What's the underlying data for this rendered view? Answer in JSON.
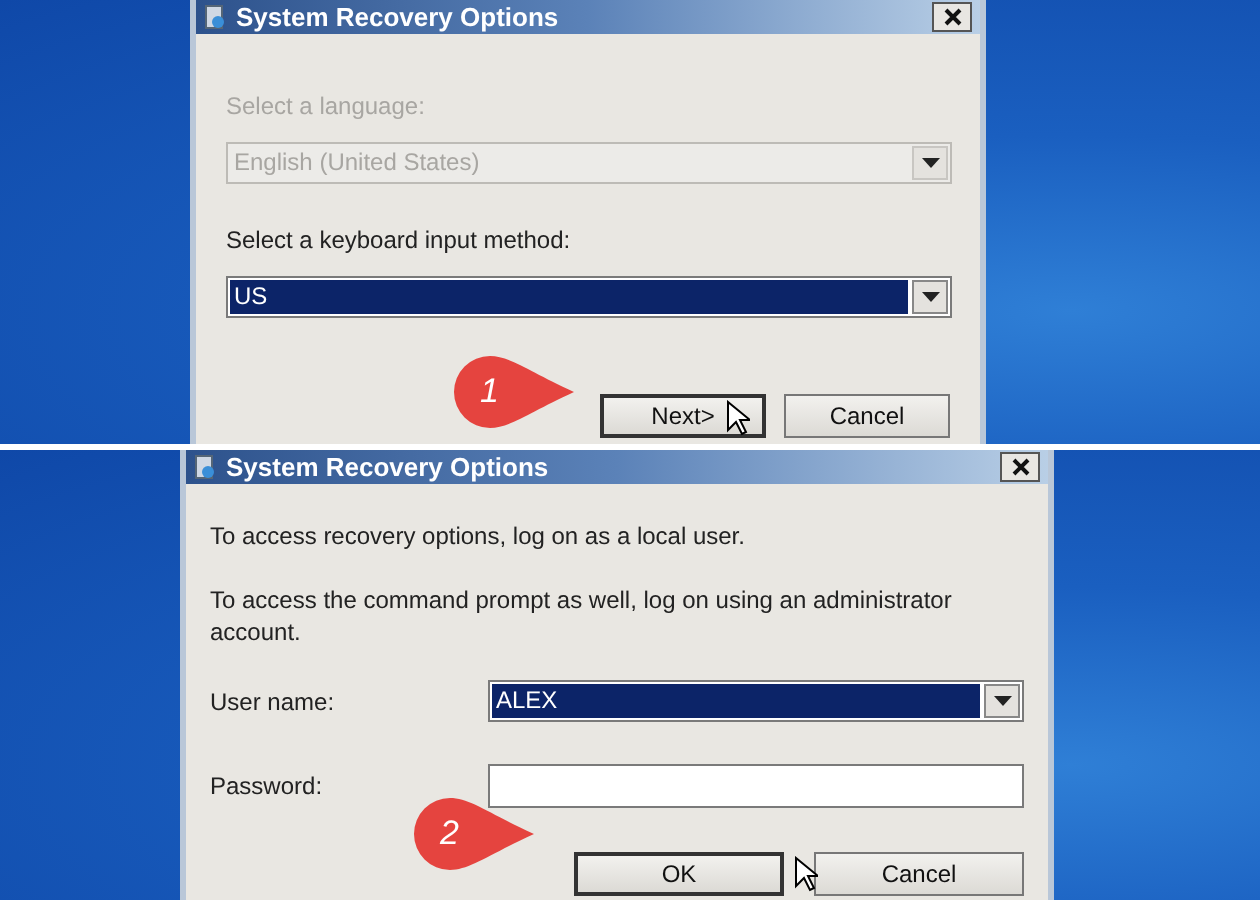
{
  "panels": [
    {
      "kind": "language",
      "title": "System Recovery Options",
      "fields": [
        {
          "kind": "combo",
          "label": "Select a language:",
          "value": "English (United States)",
          "disabled": true
        },
        {
          "kind": "combo",
          "label": "Select a keyboard input method:",
          "value": "US",
          "disabled": false
        }
      ],
      "buttons": [
        {
          "label": "Next>",
          "focused": true
        },
        {
          "label": "Cancel",
          "focused": false
        }
      ],
      "callout": "1"
    },
    {
      "kind": "logon",
      "title": "System Recovery Options",
      "paragraphs": [
        "To access recovery options, log on as a local user.",
        "To access the command prompt as well, log on using an administrator account."
      ],
      "fields": [
        {
          "kind": "combo",
          "label": "User name:",
          "value": "ALEX",
          "disabled": false
        },
        {
          "kind": "text",
          "label": "Password:"
        }
      ],
      "buttons": [
        {
          "label": "OK",
          "focused": true
        },
        {
          "label": "Cancel",
          "focused": false
        }
      ],
      "callout": "2"
    }
  ]
}
